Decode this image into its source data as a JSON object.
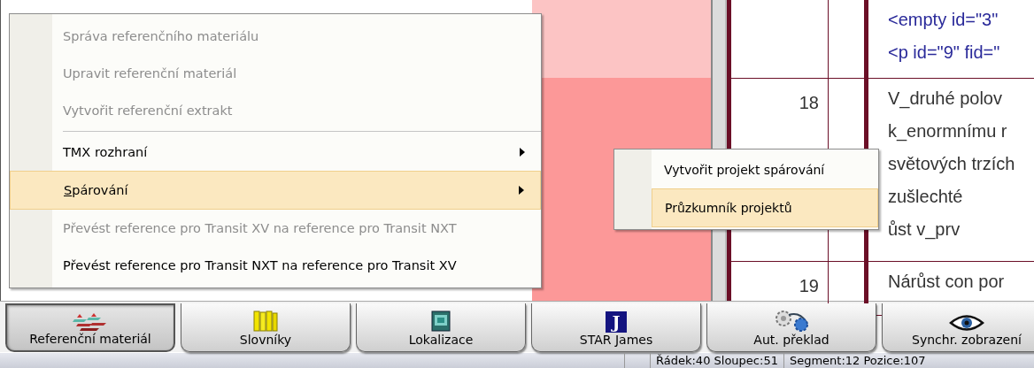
{
  "editor": {
    "rows": [
      {
        "number": "",
        "lines": [
          {
            "text": "<empty id=\"3\"",
            "kind": "tag"
          },
          {
            "text": "<p id=\"9\" fid=\"",
            "kind": "tag"
          }
        ]
      },
      {
        "number": "18",
        "lines": [
          {
            "text": "V_druhé polov",
            "kind": "plain"
          },
          {
            "text": "k_enormnímu r",
            "kind": "plain"
          },
          {
            "text": "světových trzích",
            "kind": "plain"
          },
          {
            "text": "zušlechté",
            "kind": "plain"
          },
          {
            "text": "ůst v_prv",
            "kind": "plain"
          }
        ]
      },
      {
        "number": "19",
        "lines": [
          {
            "text": "Nárůst con por",
            "kind": "plain"
          }
        ]
      }
    ]
  },
  "menu": {
    "items": [
      {
        "kind": "item",
        "label": "Správa referenčního materiálu",
        "disabled": true,
        "selected": false,
        "submenu": false
      },
      {
        "kind": "item",
        "label": "Upravit referenční materiál",
        "disabled": true,
        "selected": false,
        "submenu": false
      },
      {
        "kind": "item",
        "label": "Vytvořit referenční extrakt",
        "disabled": true,
        "selected": false,
        "submenu": false
      },
      {
        "kind": "separator"
      },
      {
        "kind": "item",
        "label": "TMX rozhraní",
        "disabled": false,
        "selected": false,
        "submenu": true
      },
      {
        "kind": "item",
        "label": "Spárování",
        "mnemonic_underlined": true,
        "disabled": false,
        "selected": true,
        "submenu": true
      },
      {
        "kind": "item",
        "label": "Převést reference pro Transit XV na reference pro Transit NXT",
        "disabled": true,
        "selected": false,
        "submenu": false
      },
      {
        "kind": "item",
        "label": "Převést reference pro Transit NXT na reference pro Transit XV",
        "disabled": false,
        "selected": false,
        "submenu": false
      }
    ]
  },
  "submenu": {
    "items": [
      {
        "label": "Vytvořit projekt spárování",
        "selected": false
      },
      {
        "label": "Průzkumník projektů",
        "selected": true
      }
    ]
  },
  "toolbar": {
    "buttons": [
      {
        "label": "Referenční materiál",
        "kind": "stack",
        "selected": true
      },
      {
        "label": "Slovníky",
        "kind": "books",
        "selected": false
      },
      {
        "label": "Lokalizace",
        "kind": "window",
        "selected": false
      },
      {
        "label": "STAR James",
        "kind": "badge",
        "badge": "J",
        "selected": false
      },
      {
        "label": "Aut. překlad",
        "kind": "gears",
        "selected": false
      },
      {
        "label": "Synchr. zobrazení",
        "kind": "eye",
        "selected": false
      }
    ]
  },
  "status_bar": {
    "fields": [
      "Řádek:40 Sloupec:51",
      "Segment:12 Pozice:107"
    ]
  }
}
